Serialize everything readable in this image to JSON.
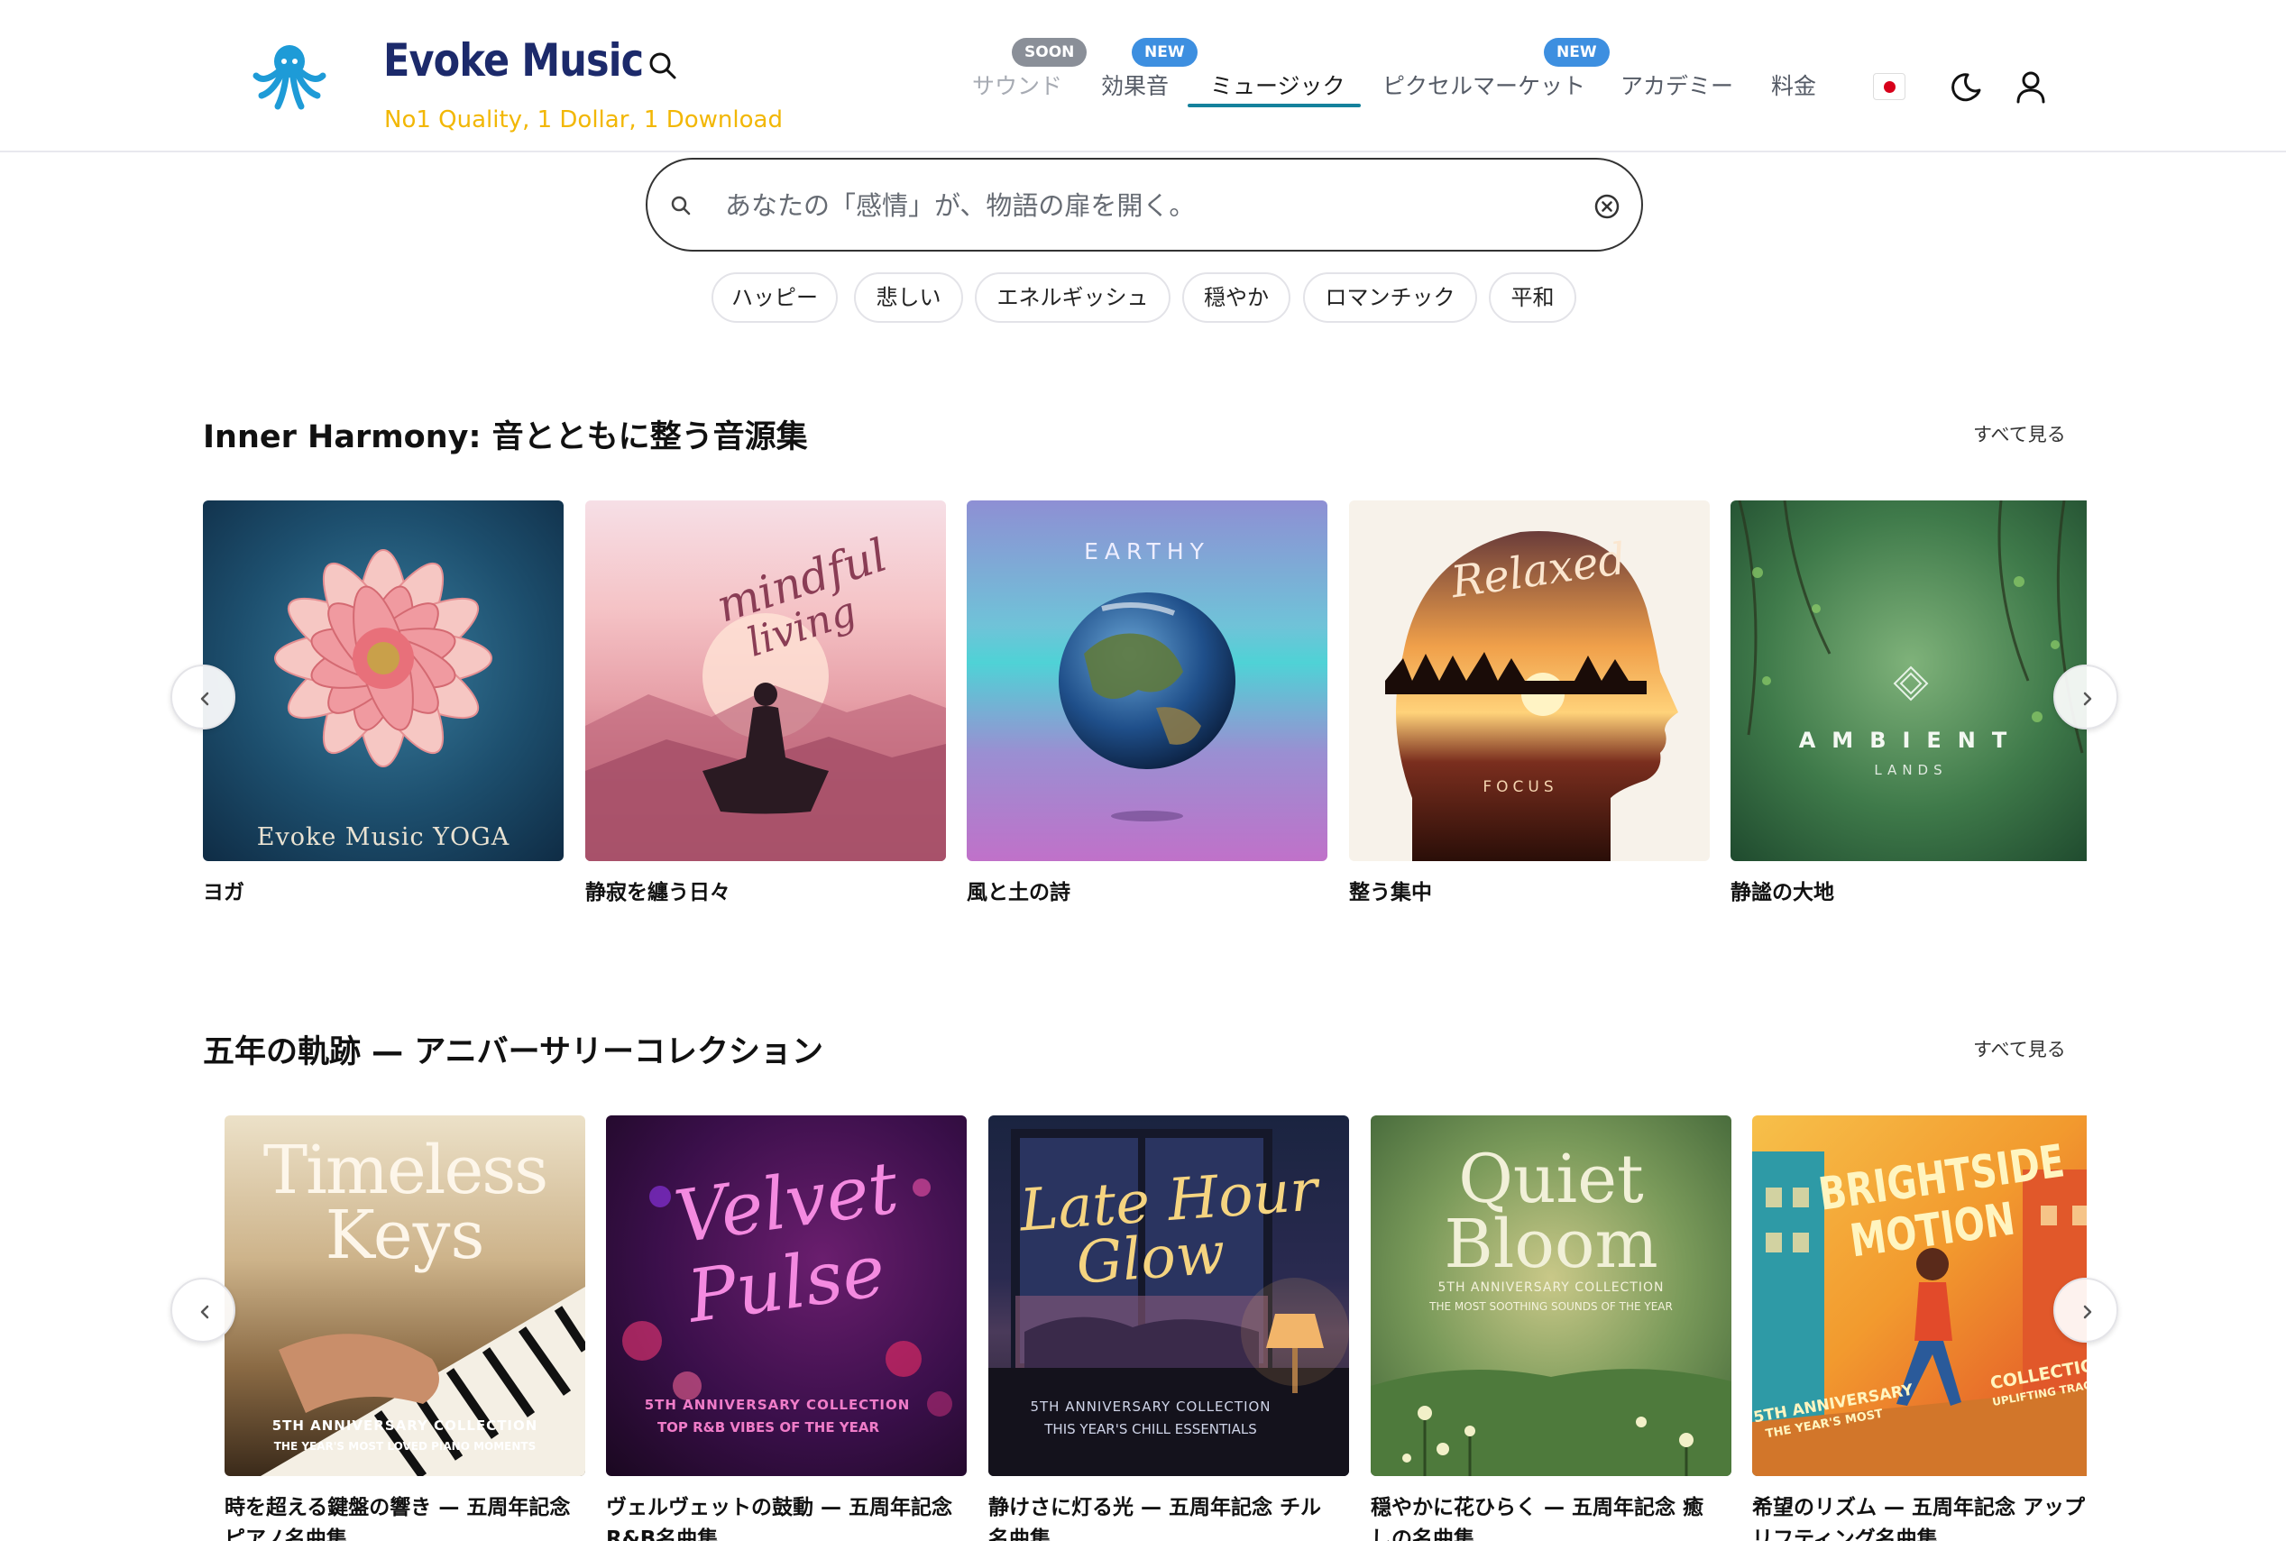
{
  "header": {
    "brand": "Evoke Music",
    "tagline": "No1 Quality, 1 Dollar, 1 Download",
    "nav": [
      {
        "label": "サウンド",
        "badge": "SOON"
      },
      {
        "label": "効果音",
        "badge": "NEW"
      },
      {
        "label": "ミュージック",
        "badge": ""
      },
      {
        "label": "ピクセルマーケット",
        "badge": "NEW"
      },
      {
        "label": "アカデミー",
        "badge": ""
      },
      {
        "label": "料金",
        "badge": ""
      }
    ],
    "active_nav": "ミュージック"
  },
  "search": {
    "placeholder": "あなたの「感情」が、物語の扉を開く。",
    "moods": [
      "ハッピー",
      "悲しい",
      "エネルギッシュ",
      "穏やか",
      "ロマンチック",
      "平和"
    ]
  },
  "sections": [
    {
      "title": "Inner Harmony: 音とともに整う音源集",
      "see_all": "すべて見る",
      "cards": [
        {
          "label": "ヨガ",
          "art_text": "Evoke Music YOGA"
        },
        {
          "label": "静寂を纏う日々",
          "art_text_1": "mindful",
          "art_text_2": "living"
        },
        {
          "label": "風と土の詩",
          "art_text": "EARTHY"
        },
        {
          "label": "整う集中",
          "art_text_1": "Relaxed",
          "art_text_2": "FOCUS"
        },
        {
          "label": "静謐の大地",
          "art_text_1": "AMBIENT",
          "art_text_2": "LANDS"
        }
      ]
    },
    {
      "title": "五年の軌跡 — アニバーサリーコレクション",
      "see_all": "すべて見る",
      "cards": [
        {
          "label_1": "時を超える鍵盤の響き — 五周年記念",
          "label_2": "ピアノ名曲集",
          "art_1": "Timeless",
          "art_2": "Keys",
          "art_3": "5TH ANNIVERSARY COLLECTION",
          "art_4": "THE YEAR'S MOST LOVED PIANO MOMENTS"
        },
        {
          "label_1": "ヴェルヴェットの鼓動 — 五周年記念",
          "label_2": "R&B名曲集",
          "art_1": "Velvet",
          "art_2": "Pulse",
          "art_3": "5TH ANNIVERSARY COLLECTION",
          "art_4": "TOP R&B VIBES OF THE YEAR"
        },
        {
          "label_1": "静けさに灯る光 — 五周年記念 チル",
          "label_2": "名曲集",
          "art_1": "Late Hour",
          "art_2": "Glow",
          "art_3": "5TH ANNIVERSARY COLLECTION",
          "art_4": "THIS YEAR'S CHILL ESSENTIALS"
        },
        {
          "label_1": "穏やかに花ひらく — 五周年記念 癒",
          "label_2": "しの名曲集",
          "art_1": "Quiet",
          "art_2": "Bloom",
          "art_3": "5TH ANNIVERSARY COLLECTION",
          "art_4": "THE MOST SOOTHING SOUNDS OF THE YEAR"
        },
        {
          "label_1": "希望のリズム — 五周年記念 アップ",
          "label_2": "リフティング名曲集",
          "art_1": "BRIGHTSIDE",
          "art_2": "MOTION",
          "art_3": "5TH ANNIVERSARY",
          "art_4": "THE YEAR'S MOST",
          "art_5": "COLLECTION",
          "art_6": "UPLIFTING TRACKS"
        }
      ]
    }
  ],
  "colors": {
    "brand_navy": "#1c2a6b",
    "tagline_yellow": "#f2b705",
    "accent_teal": "#15819c",
    "logo_blue": "#1e9bd7",
    "badge_new": "#3d8fe0",
    "badge_soon": "#8a8f98"
  },
  "icons": {
    "logo": "octopus-logo-icon",
    "search": "search-icon",
    "clear": "clear-icon",
    "theme": "moon-icon",
    "account": "user-icon",
    "language": "japan-flag-icon",
    "prev": "chevron-left-icon",
    "next": "chevron-right-icon"
  }
}
